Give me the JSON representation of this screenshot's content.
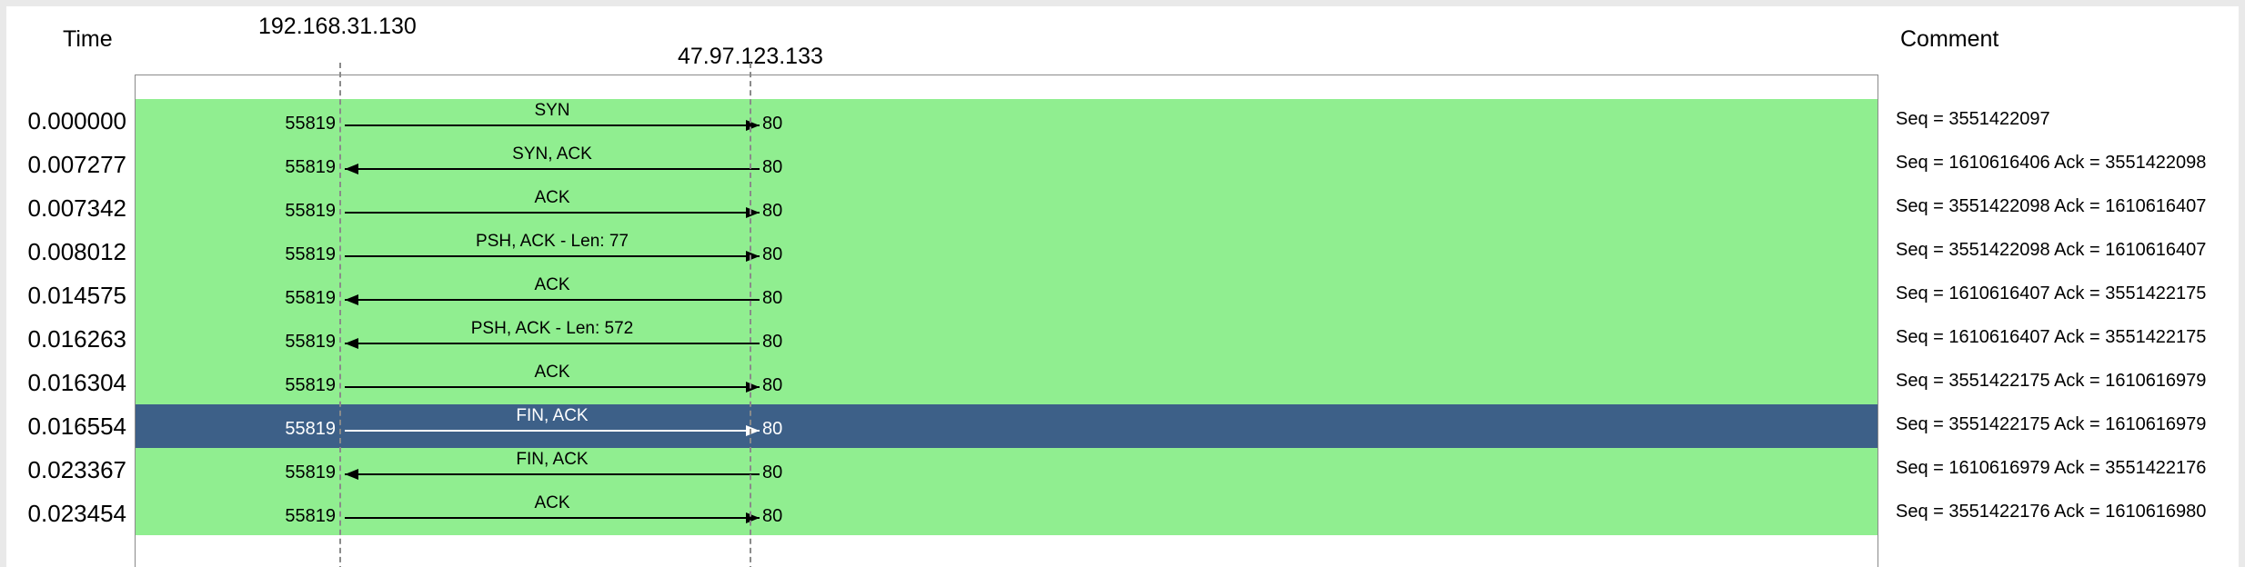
{
  "header": {
    "time_title": "Time",
    "host_a": "192.168.31.130",
    "host_b": "47.97.123.133",
    "comment_title": "Comment"
  },
  "colors": {
    "row_background": "#90ee90",
    "selected_background": "#3d6088",
    "text": "#000000",
    "selected_text": "#ffffff"
  },
  "flows": [
    {
      "time": "0.000000",
      "src_port": "55819",
      "dst_port": "80",
      "label": "SYN",
      "direction": "right",
      "comment": "Seq = 3551422097",
      "selected": false
    },
    {
      "time": "0.007277",
      "src_port": "55819",
      "dst_port": "80",
      "label": "SYN, ACK",
      "direction": "left",
      "comment": "Seq = 1610616406 Ack = 3551422098",
      "selected": false
    },
    {
      "time": "0.007342",
      "src_port": "55819",
      "dst_port": "80",
      "label": "ACK",
      "direction": "right",
      "comment": "Seq = 3551422098 Ack = 1610616407",
      "selected": false
    },
    {
      "time": "0.008012",
      "src_port": "55819",
      "dst_port": "80",
      "label": "PSH, ACK - Len: 77",
      "direction": "right",
      "comment": "Seq = 3551422098 Ack = 1610616407",
      "selected": false
    },
    {
      "time": "0.014575",
      "src_port": "55819",
      "dst_port": "80",
      "label": "ACK",
      "direction": "left",
      "comment": "Seq = 1610616407 Ack = 3551422175",
      "selected": false
    },
    {
      "time": "0.016263",
      "src_port": "55819",
      "dst_port": "80",
      "label": "PSH, ACK - Len: 572",
      "direction": "left",
      "comment": "Seq = 1610616407 Ack = 3551422175",
      "selected": false
    },
    {
      "time": "0.016304",
      "src_port": "55819",
      "dst_port": "80",
      "label": "ACK",
      "direction": "right",
      "comment": "Seq = 3551422175 Ack = 1610616979",
      "selected": false
    },
    {
      "time": "0.016554",
      "src_port": "55819",
      "dst_port": "80",
      "label": "FIN, ACK",
      "direction": "right",
      "comment": "Seq = 3551422175 Ack = 1610616979",
      "selected": true
    },
    {
      "time": "0.023367",
      "src_port": "55819",
      "dst_port": "80",
      "label": "FIN, ACK",
      "direction": "left",
      "comment": "Seq = 1610616979 Ack = 3551422176",
      "selected": false
    },
    {
      "time": "0.023454",
      "src_port": "55819",
      "dst_port": "80",
      "label": "ACK",
      "direction": "right",
      "comment": "Seq = 3551422176 Ack = 1610616980",
      "selected": false
    }
  ]
}
